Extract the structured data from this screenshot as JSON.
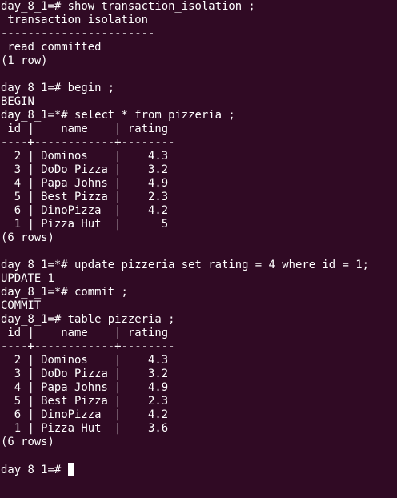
{
  "terminal": {
    "background": "#300a24",
    "foreground": "#ffffff",
    "lines": [
      "day_8_1=# show transaction_isolation ;",
      " transaction_isolation",
      "-----------------------",
      " read committed",
      "(1 row)",
      "",
      "day_8_1=# begin ;",
      "BEGIN",
      "day_8_1=*# select * from pizzeria ;",
      " id |    name    | rating",
      "----+------------+--------",
      "  2 | Dominos    |    4.3",
      "  3 | DoDo Pizza |    3.2",
      "  4 | Papa Johns |    4.9",
      "  5 | Best Pizza |    2.3",
      "  6 | DinoPizza  |    4.2",
      "  1 | Pizza Hut  |      5",
      "(6 rows)",
      "",
      "day_8_1=*# update pizzeria set rating = 4 where id = 1;",
      "UPDATE 1",
      "day_8_1=*# commit ;",
      "COMMIT",
      "day_8_1=# table pizzeria ;",
      " id |    name    | rating",
      "----+------------+--------",
      "  2 | Dominos    |    4.3",
      "  3 | DoDo Pizza |    3.2",
      "  4 | Papa Johns |    4.9",
      "  5 | Best Pizza |    2.3",
      "  6 | DinoPizza  |    4.2",
      "  1 | Pizza Hut  |    3.6",
      "(6 rows)",
      ""
    ],
    "prompt": "day_8_1=# "
  }
}
